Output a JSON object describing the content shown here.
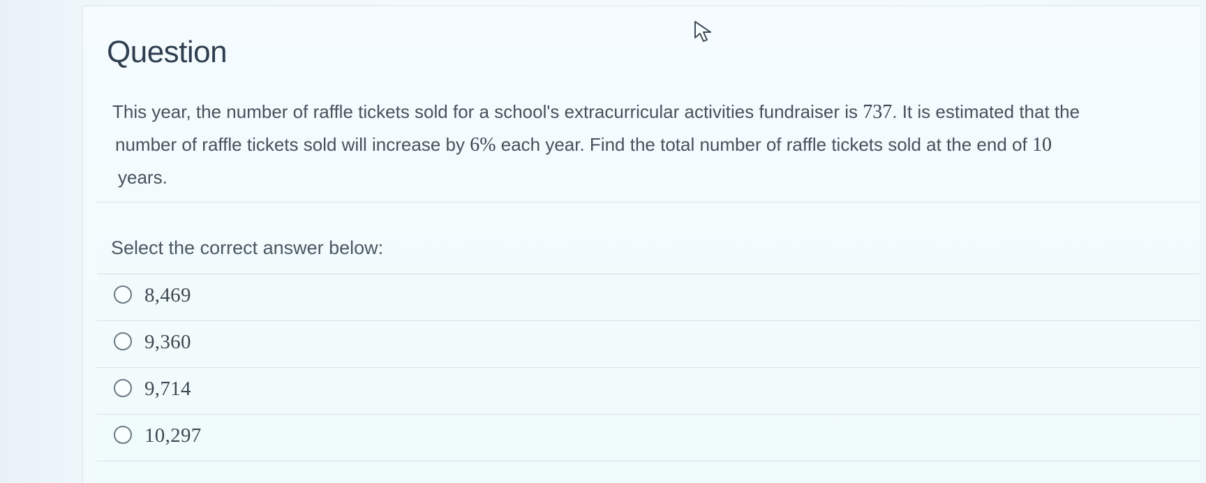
{
  "question": {
    "title": "Question",
    "line_1_prefix": "This year, the number of raffle tickets sold for a school's extracurricular activities fundraiser is ",
    "line_1_number": "737",
    "line_1_suffix": ". It is estimated that the",
    "line_2_prefix": "number of raffle tickets sold will increase by ",
    "line_2_number": "6%",
    "line_2_middle": " each year. Find the total number of raffle tickets sold at the end of ",
    "line_2_years": "10",
    "line_3": "years."
  },
  "answer": {
    "select_label": "Select the correct answer below:",
    "options": [
      {
        "label": "8,469"
      },
      {
        "label": "9,360"
      },
      {
        "label": "9,714"
      },
      {
        "label": "10,297"
      }
    ]
  },
  "colors": {
    "background": "#f3f9fc",
    "text": "#45515b",
    "divider": "#d6e2e8",
    "radio_border": "#6b7782"
  },
  "icons": {
    "cursor": "mouse-pointer-icon",
    "radio": "radio-unchecked-icon"
  }
}
